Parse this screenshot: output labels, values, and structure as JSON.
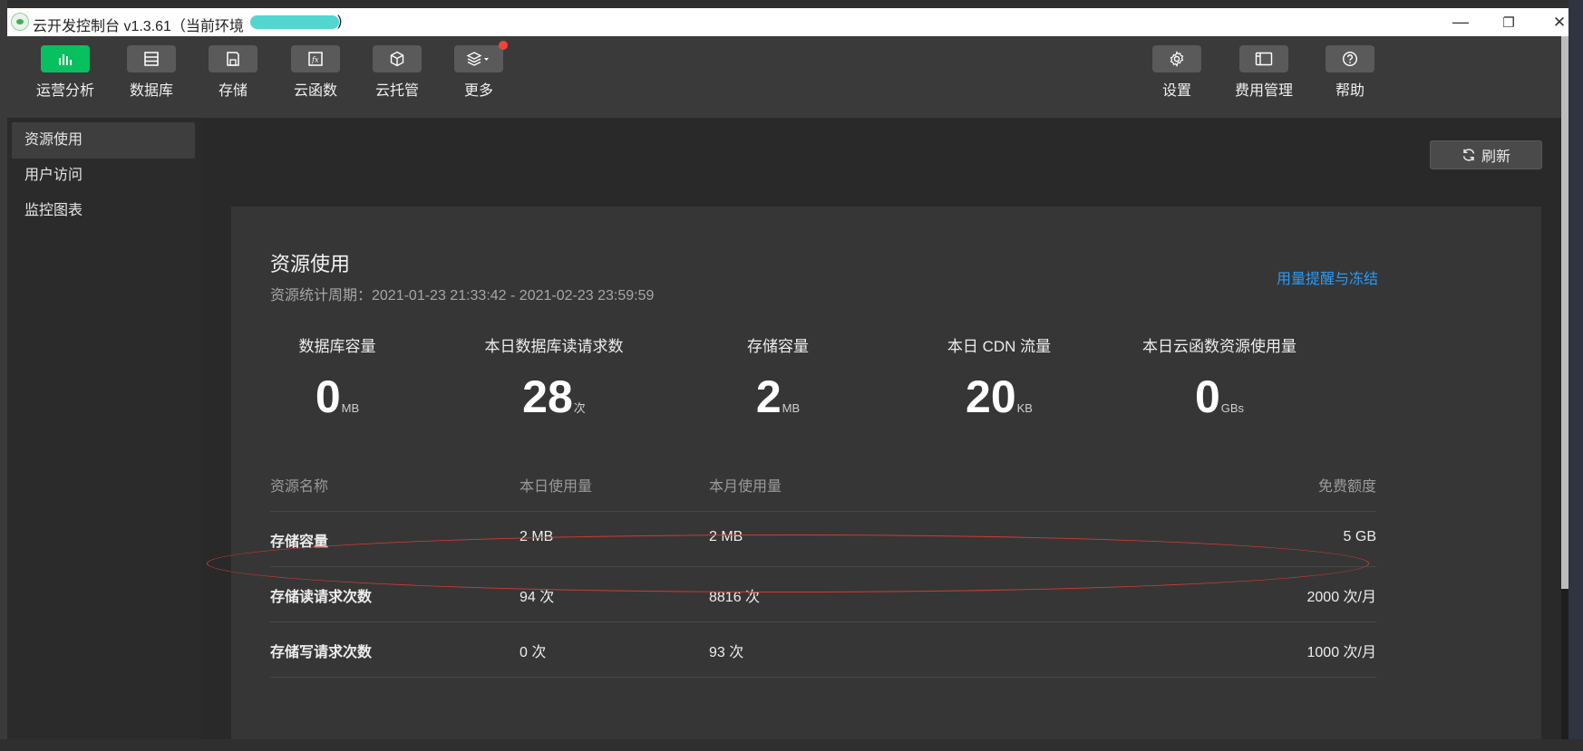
{
  "window": {
    "title": "云开发控制台 v1.3.61（当前环境",
    "title_suffix": ")",
    "minimize": "—",
    "maximize": "❐",
    "close": "✕"
  },
  "toolbar": {
    "items": [
      {
        "label": "运营分析",
        "icon": "bar-chart-icon",
        "active": true
      },
      {
        "label": "数据库",
        "icon": "database-icon"
      },
      {
        "label": "存储",
        "icon": "storage-icon"
      },
      {
        "label": "云函数",
        "icon": "cloud-function-icon"
      },
      {
        "label": "云托管",
        "icon": "cube-icon"
      },
      {
        "label": "更多",
        "icon": "layers-icon"
      }
    ],
    "right_items": [
      {
        "label": "设置",
        "icon": "gear-icon"
      },
      {
        "label": "费用管理",
        "icon": "billing-icon"
      },
      {
        "label": "帮助",
        "icon": "help-icon"
      }
    ]
  },
  "sidebar": {
    "items": [
      {
        "label": "资源使用",
        "active": true
      },
      {
        "label": "用户访问"
      },
      {
        "label": "监控图表"
      }
    ]
  },
  "main": {
    "refresh_label": "刷新",
    "card": {
      "title": "资源使用",
      "subtitle": "资源统计周期：2021-01-23 21:33:42 - 2021-02-23 23:59:59",
      "link": "用量提醒与冻结",
      "stats": [
        {
          "label": "数据库容量",
          "value": "0",
          "unit": "MB"
        },
        {
          "label": "本日数据库读请求数",
          "value": "28",
          "unit": "次"
        },
        {
          "label": "存储容量",
          "value": "2",
          "unit": "MB"
        },
        {
          "label": "本日 CDN 流量",
          "value": "20",
          "unit": "KB"
        },
        {
          "label": "本日云函数资源使用量",
          "value": "0",
          "unit": "GBs"
        }
      ],
      "table": {
        "headers": [
          "资源名称",
          "本日使用量",
          "本月使用量",
          "免费额度"
        ],
        "rows": [
          [
            "存储容量",
            "2 MB",
            "2 MB",
            "5 GB"
          ],
          [
            "存储读请求次数",
            "94 次",
            "8816 次",
            "2000 次/月"
          ],
          [
            "存储写请求次数",
            "0 次",
            "93 次",
            "1000 次/月"
          ]
        ]
      }
    }
  },
  "colors": {
    "accent_green": "#07c160",
    "link_blue": "#2b9bf4",
    "annotation_red": "#d23b36"
  }
}
